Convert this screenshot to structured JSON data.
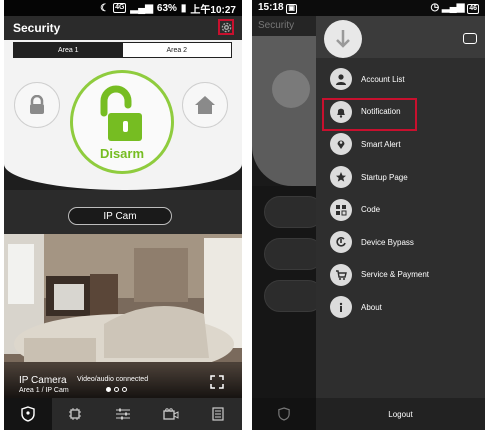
{
  "left": {
    "status_bar": {
      "network": "4G",
      "battery": "63%",
      "time": "上午10:27"
    },
    "header": {
      "title": "Security"
    },
    "area_tabs": [
      {
        "label": "Area 1",
        "selected": true
      },
      {
        "label": "Area 2",
        "selected": false
      }
    ],
    "disarm_label": "Disarm",
    "ipcam_button": "IP Cam",
    "camera": {
      "title": "IP Camera",
      "status": "Video/audio connected",
      "subtitle": "Area 1 / IP Cam"
    },
    "bottom_nav": [
      "shield-icon",
      "chip-icon",
      "sliders-icon",
      "camera-icon",
      "list-icon"
    ],
    "colors": {
      "accent": "#76bd22",
      "highlight": "#c8102e"
    }
  },
  "right": {
    "status_bar": {
      "time": "15:18",
      "battery": "46"
    },
    "background_title": "Security",
    "menu": [
      {
        "label": "Account List",
        "icon": "user-icon"
      },
      {
        "label": "Notification",
        "icon": "bell-icon",
        "highlighted": true
      },
      {
        "label": "Smart Alert",
        "icon": "pin-icon"
      },
      {
        "label": "Startup Page",
        "icon": "star-icon"
      },
      {
        "label": "Code",
        "icon": "code-icon"
      },
      {
        "label": "Device Bypass",
        "icon": "bypass-icon"
      },
      {
        "label": "Service & Payment",
        "icon": "cart-icon"
      },
      {
        "label": "About",
        "icon": "info-icon"
      }
    ],
    "logout_label": "Logout"
  }
}
